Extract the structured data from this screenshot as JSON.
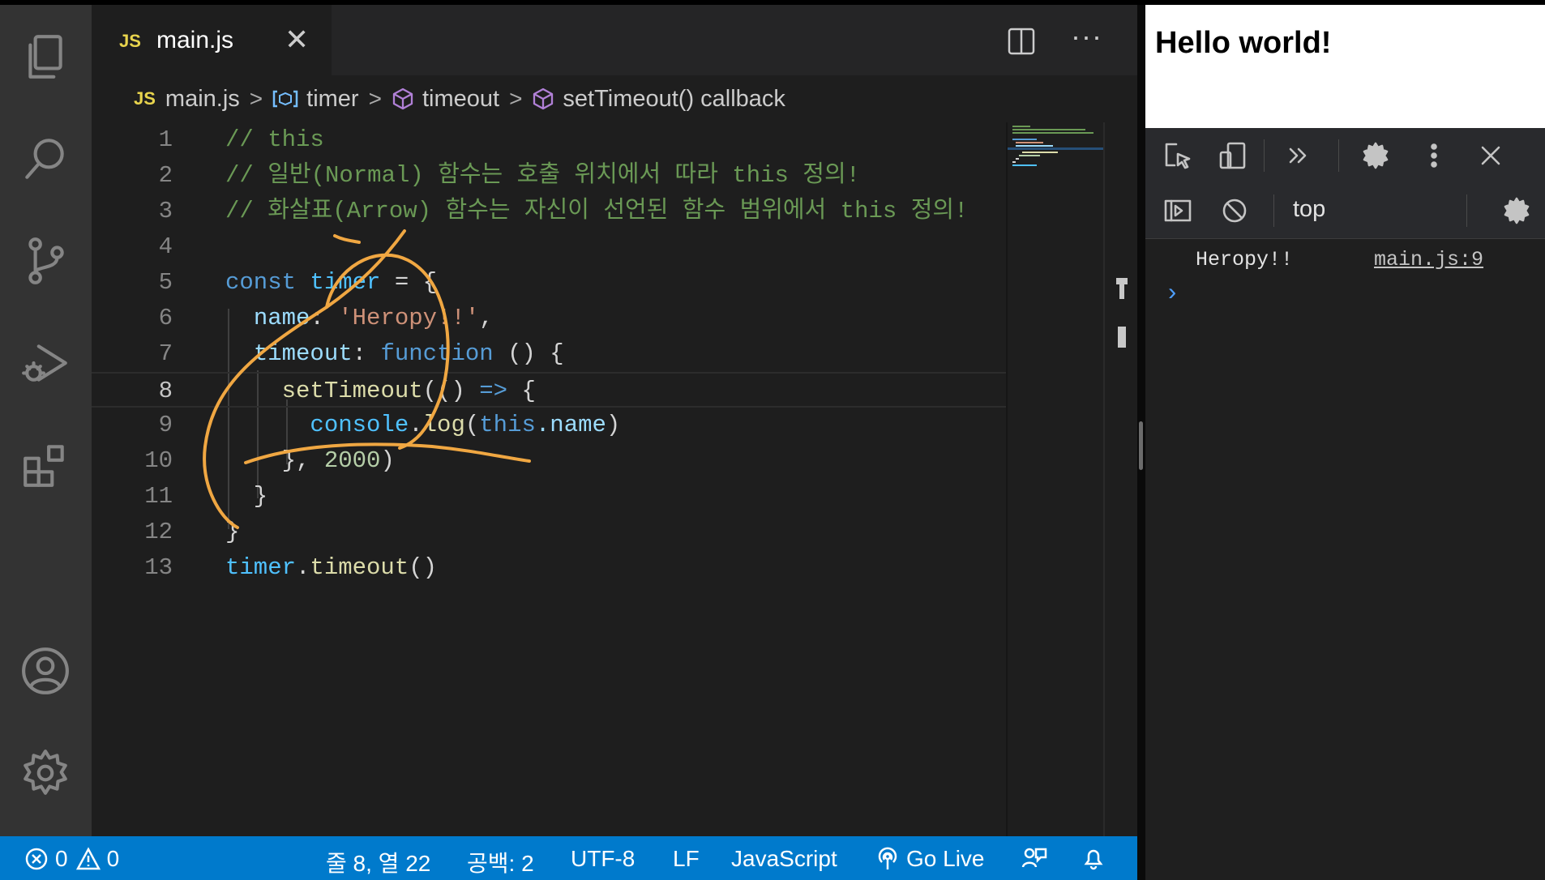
{
  "editor_tab": {
    "badge": "JS",
    "title": "main.js",
    "close": "✕"
  },
  "more_actions": "···",
  "breadcrumb": {
    "file": "main.js",
    "items": [
      "timer",
      "timeout",
      "setTimeout() callback"
    ]
  },
  "code_lines": [
    {
      "n": "1",
      "text": "// this"
    },
    {
      "n": "2",
      "text": "// 일반(Normal) 함수는 호출 위치에서 따라 this 정의!"
    },
    {
      "n": "3",
      "text": "// 화살표(Arrow) 함수는 자신이 선언된 함수 범위에서 this 정의!"
    },
    {
      "n": "4",
      "text": ""
    },
    {
      "n": "5",
      "text": "const timer = {"
    },
    {
      "n": "6",
      "text": "  name: 'Heropy!!',"
    },
    {
      "n": "7",
      "text": "  timeout: function () {"
    },
    {
      "n": "8",
      "text": "    setTimeout(() => {"
    },
    {
      "n": "9",
      "text": "      console.log(this.name)"
    },
    {
      "n": "10",
      "text": "    }, 2000)"
    },
    {
      "n": "11",
      "text": "  }"
    },
    {
      "n": "12",
      "text": "}"
    },
    {
      "n": "13",
      "text": "timer.timeout()"
    }
  ],
  "status_bar": {
    "errors": "0",
    "warnings": "0",
    "cursor": "줄 8, 열 22",
    "spaces": "공백: 2",
    "encoding": "UTF-8",
    "eol": "LF",
    "language": "JavaScript",
    "go_live": "Go Live"
  },
  "browser": {
    "page_heading": "Hello world!",
    "devtools": {
      "context": "top",
      "console_messages": [
        {
          "text": "Heropy!!",
          "source": "main.js:9"
        }
      ],
      "prompt": "›"
    }
  },
  "colors": {
    "status_bar": "#007acc",
    "editor_bg": "#1e1e1e",
    "annotation_stroke": "#f0a742"
  }
}
